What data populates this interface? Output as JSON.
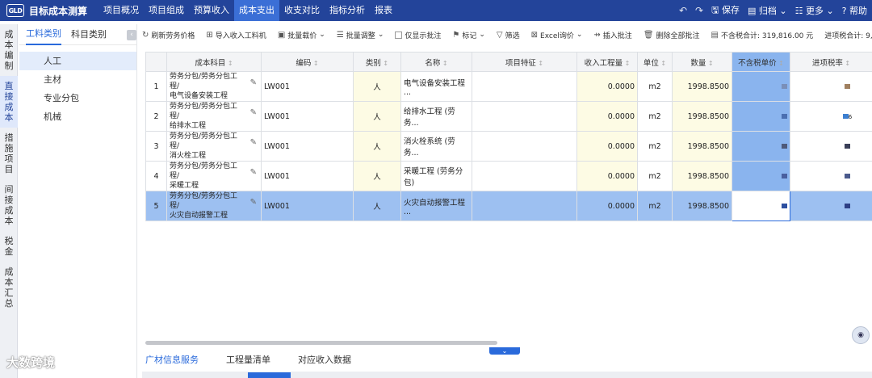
{
  "app": {
    "logo_text": "GLD",
    "title": "目标成本测算"
  },
  "nav_tabs": [
    {
      "label": "项目概况"
    },
    {
      "label": "项目组成"
    },
    {
      "label": "预算收入"
    },
    {
      "label": "成本支出"
    },
    {
      "label": "收支对比"
    },
    {
      "label": "指标分析"
    },
    {
      "label": "报表"
    }
  ],
  "active_nav": 3,
  "top_actions": {
    "save": "保存",
    "archive": "归档",
    "more": "更多",
    "help": "帮助"
  },
  "left_nav": [
    {
      "label": "成本编制"
    },
    {
      "label": "直接成本"
    },
    {
      "label": "措施项目"
    },
    {
      "label": "间接成本"
    },
    {
      "label": "税金"
    },
    {
      "label": "成本汇总"
    }
  ],
  "category_tabs": [
    {
      "label": "工料类别"
    },
    {
      "label": "科目类别"
    }
  ],
  "categories": [
    {
      "label": "人工"
    },
    {
      "label": "主材"
    },
    {
      "label": "专业分包"
    },
    {
      "label": "机械"
    }
  ],
  "toolbar": {
    "refresh": "刷新劳务价格",
    "import": "导入收入工料机",
    "batch_query": "批量载价",
    "batch_adjust": "批量调整",
    "show_only_comment": "仅显示批注",
    "mark": "标记",
    "filter": "筛选",
    "excel": "Excel询价",
    "insert_comment": "插入批注",
    "delete_all_comment": "删除全部批注",
    "total_excl_tax": "不含税合计: 319,816.00 元",
    "total_incl_tax": "进项税合计: 9,594."
  },
  "columns": [
    "",
    "成本科目",
    "编码",
    "类别",
    "名称",
    "项目特征",
    "收入工程量",
    "单位",
    "数量",
    "不含税单价",
    "进项税率"
  ],
  "rows": [
    {
      "no": "1",
      "subject1": "劳务分包/劳务分包工程/",
      "subject2": "电气设备安装工程",
      "code": "LW001",
      "type": "人",
      "name": "电气设备安装工程 ...",
      "feature": "",
      "income_qty": "0.0000",
      "unit": "m2",
      "qty": "1998.8500",
      "price": "",
      "tax": ""
    },
    {
      "no": "2",
      "subject1": "劳务分包/劳务分包工程/",
      "subject2": "给排水工程",
      "code": "LW001",
      "type": "人",
      "name": "给排水工程 (劳务...",
      "feature": "",
      "income_qty": "0.0000",
      "unit": "m2",
      "qty": "1998.8500",
      "price": "",
      "tax": "6"
    },
    {
      "no": "3",
      "subject1": "劳务分包/劳务分包工程/",
      "subject2": "消火栓工程",
      "code": "LW001",
      "type": "人",
      "name": "消火栓系统 (劳务...",
      "feature": "",
      "income_qty": "0.0000",
      "unit": "m2",
      "qty": "1998.8500",
      "price": "",
      "tax": ""
    },
    {
      "no": "4",
      "subject1": "劳务分包/劳务分包工程/",
      "subject2": "采暖工程",
      "code": "LW001",
      "type": "人",
      "name": "采暖工程 (劳务分包)",
      "feature": "",
      "income_qty": "0.0000",
      "unit": "m2",
      "qty": "1998.8500",
      "price": "",
      "tax": ""
    },
    {
      "no": "5",
      "subject1": "劳务分包/劳务分包工程/",
      "subject2": "火灾自动报警工程",
      "code": "LW001",
      "type": "人",
      "name": "火灾自动报警工程 ...",
      "feature": "",
      "income_qty": "0.0000",
      "unit": "m2",
      "qty": "1998.8500",
      "price": "",
      "tax": ""
    }
  ],
  "selected_row": 4,
  "bottom_tabs": [
    {
      "label": "广材信息服务"
    },
    {
      "label": "工程量清单"
    },
    {
      "label": "对应收入数据"
    }
  ],
  "brand_mark": "大数跨境",
  "colors": {
    "topbar": "#23449a",
    "accent": "#2a6adb",
    "price_col": "#8ab4ee",
    "selected_row": "#9dc0f1",
    "qty_col": "#fdfbe4"
  }
}
